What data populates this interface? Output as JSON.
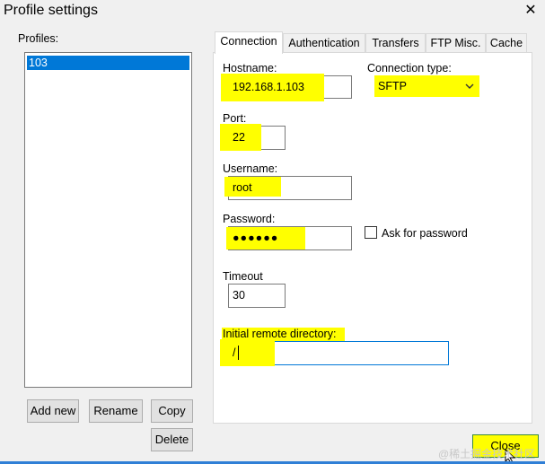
{
  "window": {
    "title": "Profile settings",
    "close_symbol": "✕"
  },
  "profiles": {
    "label": "Profiles:",
    "items": [
      "103"
    ]
  },
  "profile_buttons": {
    "add_new": "Add new",
    "rename": "Rename",
    "copy": "Copy",
    "delete": "Delete"
  },
  "tabs": [
    "Connection",
    "Authentication",
    "Transfers",
    "FTP Misc.",
    "Cache"
  ],
  "active_tab": "Connection",
  "connection": {
    "hostname_label": "Hostname:",
    "hostname_value": "192.168.1.103",
    "connection_type_label": "Connection type:",
    "connection_type_value": "SFTP",
    "port_label": "Port:",
    "port_value": "22",
    "username_label": "Username:",
    "username_value": "root",
    "password_label": "Password:",
    "password_value": "●●●●●●",
    "ask_password_label": "Ask for password",
    "ask_password_checked": false,
    "timeout_label": "Timeout",
    "timeout_value": "30",
    "remote_dir_label": "Initial remote directory:",
    "remote_dir_value": "/"
  },
  "close_button": "Close",
  "watermark": "@稀土掘金技术社区",
  "colors": {
    "highlight": "#ffff00",
    "selection": "#0078d7",
    "accent_line": "#2f7fd6"
  }
}
